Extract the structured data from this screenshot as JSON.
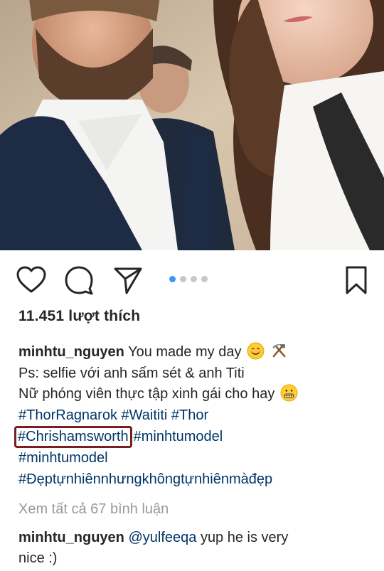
{
  "photo": {
    "description_icon": "selfie-photo"
  },
  "actions": {
    "like_icon": "heart-icon",
    "comment_icon": "comment-icon",
    "share_icon": "send-icon",
    "save_icon": "bookmark-icon",
    "carousel_total": 4,
    "carousel_active": 1
  },
  "likes": {
    "text": "11.451 lượt thích"
  },
  "caption": {
    "username": "minhtu_nguyen",
    "line1_text": "You made my day",
    "line2": "Ps: selfie với anh sấm sét & anh Titi",
    "line3": "Nữ phóng viên thực tập xinh gái cho hay",
    "tags_line1": [
      "#ThorRagnarok",
      "#Waititi",
      "#Thor"
    ],
    "highlighted_tag": "#Chrishamsworth",
    "tag_after_highlight": "#minhtumodel",
    "tag_line3": "#minhtumodel",
    "tag_line4": "#Đẹptựnhiênnhưngkhôngtựnhiênmàđẹp"
  },
  "view_all_comments": "Xem tất cả 67 bình luận",
  "comment": {
    "username": "minhtu_nguyen",
    "mention": "@yulfeeqa",
    "text_line1": "yup he is very",
    "text_line2": "nice :)"
  },
  "colors": {
    "link": "#003569",
    "accent_dot": "#3897f0",
    "highlight_box": "#7a1f1f",
    "muted": "#999999"
  }
}
